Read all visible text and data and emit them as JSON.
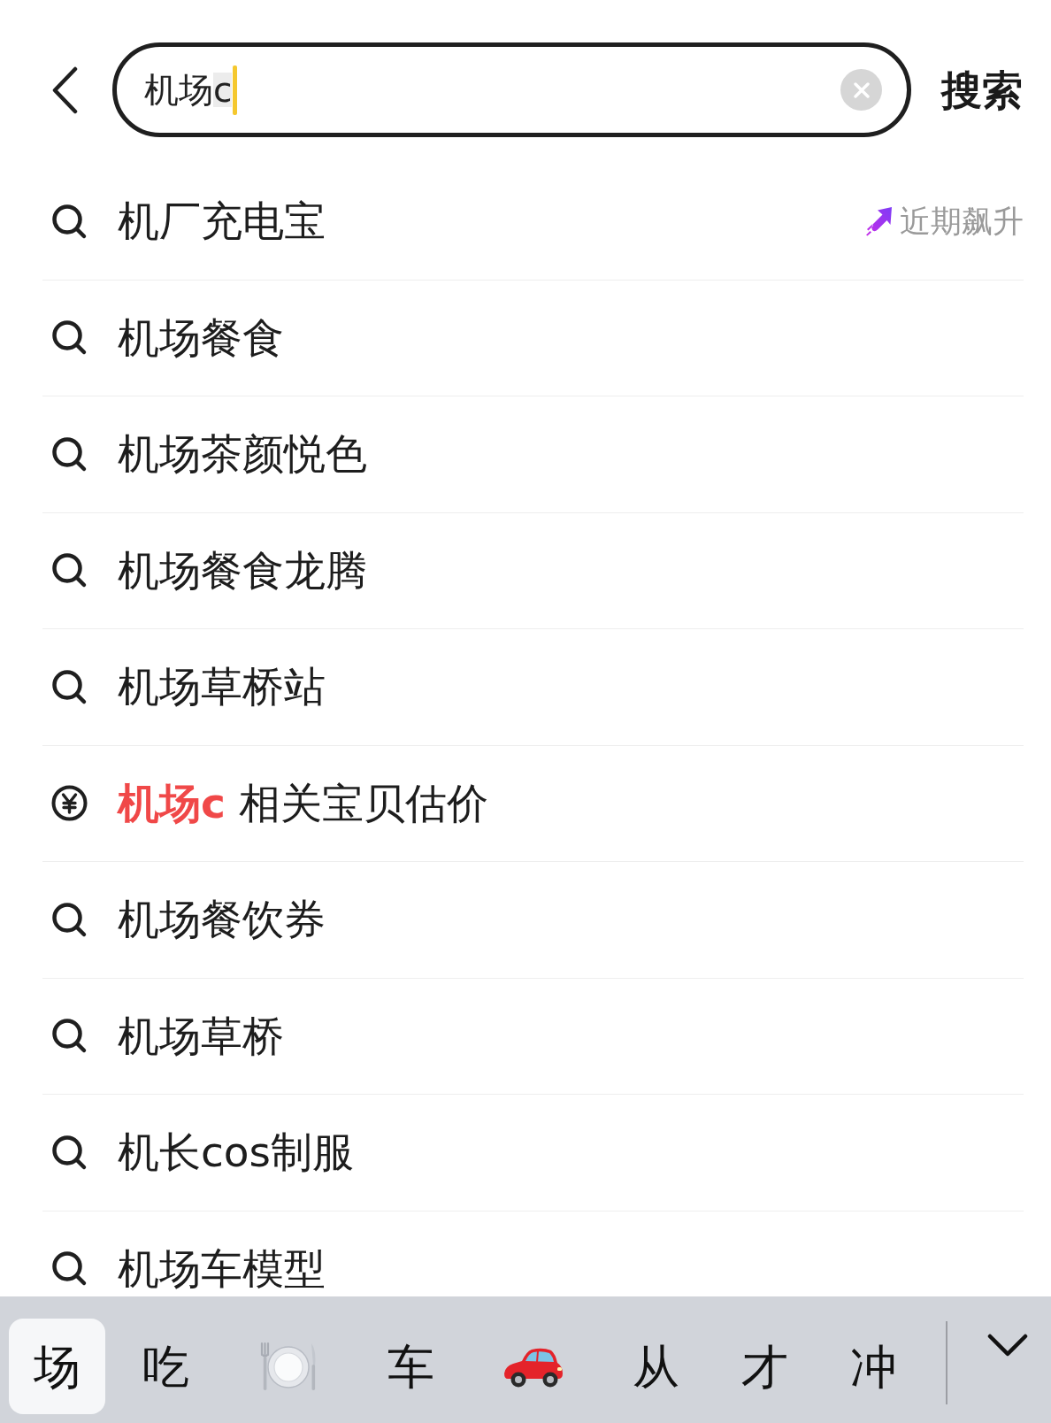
{
  "search_bar": {
    "value": "机场",
    "composing": "c",
    "focused": true,
    "button": "搜索"
  },
  "suggestions": [
    {
      "kind": "query",
      "text": "机厂充电宝",
      "badge": "近期飙升"
    },
    {
      "kind": "query",
      "text": "机场餐食"
    },
    {
      "kind": "query",
      "text": "机场茶颜悦色"
    },
    {
      "kind": "query",
      "text": "机场餐食龙腾"
    },
    {
      "kind": "query",
      "text": "机场草桥站"
    },
    {
      "kind": "price",
      "keyword": "机场c",
      "text": "相关宝贝估价"
    },
    {
      "kind": "query",
      "text": "机场餐饮券"
    },
    {
      "kind": "query",
      "text": "机场草桥"
    },
    {
      "kind": "query",
      "text": "机长cos制服"
    },
    {
      "kind": "query",
      "text": "机场车模型"
    }
  ],
  "keyboard": {
    "candidates": [
      {
        "kind": "text",
        "text": "场",
        "selected": true
      },
      {
        "kind": "text",
        "text": "吃",
        "selected": false
      },
      {
        "kind": "plate",
        "selected": false
      },
      {
        "kind": "text",
        "text": "车",
        "selected": false
      },
      {
        "kind": "car",
        "selected": false
      },
      {
        "kind": "text",
        "text": "从",
        "selected": false
      },
      {
        "kind": "text",
        "text": "才",
        "selected": false
      },
      {
        "kind": "text",
        "text": "冲",
        "selected": false
      }
    ]
  }
}
